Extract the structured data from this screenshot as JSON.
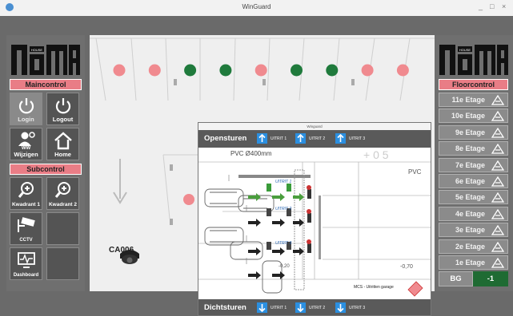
{
  "window": {
    "title": "WinGuard",
    "minimize": "_",
    "maximize": "□",
    "close": "×"
  },
  "left": {
    "logo_text": "NOMA HOUSE",
    "maincontrol_label": "Maincontrol",
    "subcontrol_label": "Subcontrol",
    "login_label": "Login",
    "logout_label": "Logout",
    "ww_label_1": "WW",
    "ww_label_2": "Wijzigen",
    "home_label": "Home",
    "kwadrant1_label": "Kwadrant 1",
    "kwadrant2_label": "Kwadrant 2",
    "cctv_label": "CCTV",
    "dashboard_label": "Dashboard"
  },
  "right": {
    "logo_text": "NOMA HOUSE",
    "floorcontrol_label": "Floorcontrol",
    "floors": [
      "11e Etage",
      "10e Etage",
      "9e Etage",
      "8e Etage",
      "7e Etage",
      "6e Etage",
      "5e Etage",
      "4e Etage",
      "3e Etage",
      "2e Etage",
      "1e Etage"
    ],
    "bg_label": "BG",
    "bg_value": "-1"
  },
  "main": {
    "camera_label": "CA006",
    "spot_colors": [
      "#f08a8f",
      "#f08a8f",
      "#1f7a3c",
      "#1f7a3c",
      "#f08a8f",
      "#1f7a3c",
      "#1f7a3c",
      "#f08a8f",
      "#f08a8f"
    ]
  },
  "popup": {
    "title": "Winguard",
    "open_label": "Opensturen",
    "close_label": "Dichtsturen",
    "uitrit1": "UITRIT 1",
    "uitrit2": "UITRIT 2",
    "uitrit3": "UITRIT 3",
    "pvc_label": "PVC Ø400mm",
    "pvc_right": "PVC",
    "plan_uitrit1": "UITRIT 1",
    "plan_uitrit2": "UITRIT 2",
    "plan_uitrit3": "UITRIT 3",
    "level_1": "-0,70",
    "level_2": "-0,20",
    "mcs_label": "MCS - Uitritten garage"
  }
}
